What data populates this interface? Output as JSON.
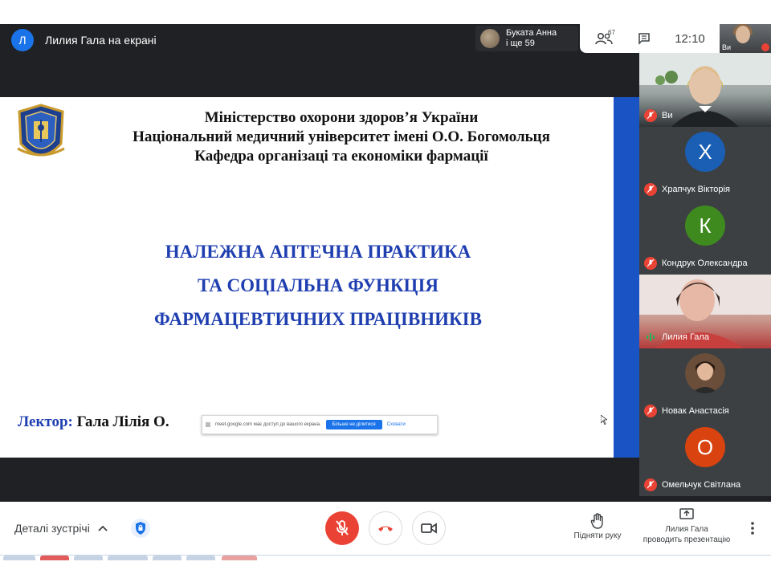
{
  "presenter": {
    "avatar_letter": "Л",
    "label": "Лилия Гала на екрані"
  },
  "speaker_chip": {
    "line1": "Буката Анна",
    "line2": "і ще 59"
  },
  "top_tools": {
    "people_count": "67",
    "clock": "12:10"
  },
  "self_view": {
    "label": "Ви"
  },
  "slide": {
    "ministry_lines": [
      "Міністерство охорони здоров’я України",
      "Національний медичний університет імені О.О. Богомольця",
      "Кафедра організаці та економіки фармації"
    ],
    "title_lines": [
      "НАЛЕЖНА АПТЕЧНА ПРАКТИКА",
      "ТА СОЦІАЛЬНА ФУНКЦІЯ",
      "ФАРМАЦЕВТИЧНИХ ПРАЦІВНИКІВ"
    ],
    "lecturer_label": "Лектор:",
    "lecturer_name": "Гала Лілія О."
  },
  "share_popup": {
    "text": "meet.google.com має доступ до вашого екрана.",
    "stop_label": "Більше не ділитися",
    "hide_label": "Сховати"
  },
  "participants": [
    {
      "name": "Ви",
      "type": "video",
      "status": "muted"
    },
    {
      "name": "Храпчук Вікторія",
      "type": "avatar",
      "letter": "Х",
      "color": "#1a5fb4",
      "status": "muted"
    },
    {
      "name": "Кондрук Олександра",
      "type": "avatar",
      "letter": "К",
      "color": "#3f8a1f",
      "status": "muted"
    },
    {
      "name": "Лилия Гала",
      "type": "video",
      "status": "speaking"
    },
    {
      "name": "Новак Анастасія",
      "type": "photo",
      "status": "muted"
    },
    {
      "name": "Омельчук Світлана",
      "type": "avatar",
      "letter": "О",
      "color": "#d9430f",
      "status": "muted"
    }
  ],
  "bottom": {
    "details_label": "Деталі зустрічі",
    "raise_hand_label": "Підняти руку",
    "present_line1": "Лилия Гала",
    "present_line2": "проводить презентацію"
  },
  "colors": {
    "accent": "#1a73e8",
    "danger": "#ea4335",
    "slide_title": "#1f3fb0",
    "slide_edge": "#1a54c4"
  }
}
